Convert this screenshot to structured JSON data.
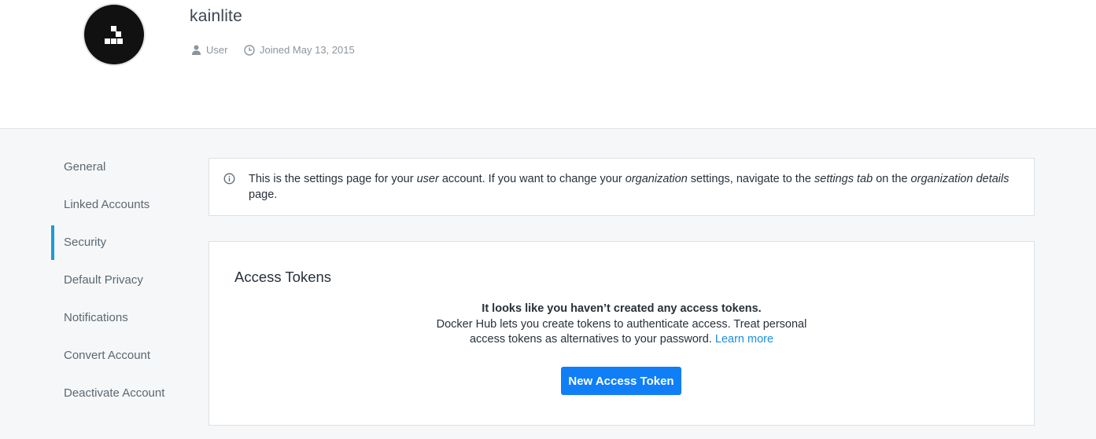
{
  "profile": {
    "username": "kainlite",
    "role": "User",
    "joined": "Joined May 13, 2015",
    "role_icon": "user-icon",
    "joined_icon": "clock-icon"
  },
  "sidebar": {
    "items": [
      {
        "label": "General"
      },
      {
        "label": "Linked Accounts"
      },
      {
        "label": "Security",
        "active": true
      },
      {
        "label": "Default Privacy"
      },
      {
        "label": "Notifications"
      },
      {
        "label": "Convert Account"
      },
      {
        "label": "Deactivate Account"
      }
    ]
  },
  "notice": {
    "icon": "info-icon",
    "t1": "This is the settings page for your ",
    "e1": "user",
    "t2": " account. If you want to change your ",
    "e2": "organization",
    "t3": " settings, navigate to the ",
    "e3": "settings tab",
    "t4": " on the ",
    "e4": "organization details",
    "t5": " page."
  },
  "tokens": {
    "title": "Access Tokens",
    "empty_headline": "It looks like you haven’t created any access tokens.",
    "empty_body": "Docker Hub lets you create tokens to authenticate access. Treat personal access tokens as alternatives to your password.",
    "learn_more": "Learn more",
    "new_button": "New Access Token"
  },
  "colors": {
    "accent": "#1a9bd7",
    "button": "#0f7ef7",
    "link": "#1a8fe0"
  }
}
